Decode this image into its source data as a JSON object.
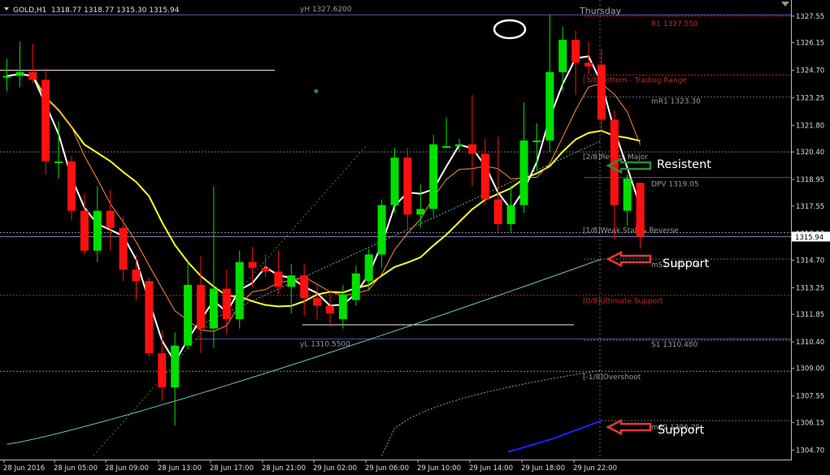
{
  "window": {
    "symbol_label": "GOLD,H1",
    "ohlc": "1318.77 1318.77 1315.30 1315.94",
    "day_label": "Thursday",
    "price_badge": "1315.94"
  },
  "chart_data": {
    "type": "candlestick",
    "title": "GOLD,H1",
    "symbol": "GOLD",
    "timeframe": "H1",
    "ylim": [
      1304.2,
      1328.4
    ],
    "y_ticks": [
      "1327.55",
      "1326.15",
      "1324.70",
      "1323.25",
      "1321.80",
      "1320.40",
      "1318.95",
      "1317.55",
      "1316.10",
      "1314.70",
      "1313.25",
      "1311.85",
      "1310.40",
      "1309.00",
      "1307.55",
      "1306.15",
      "1304.70"
    ],
    "x_ticks": [
      "28 Jun 2016",
      "28 Jun 05:00",
      "28 Jun 09:00",
      "28 Jun 13:00",
      "28 Jun 17:00",
      "28 Jun 21:00",
      "29 Jun 02:00",
      "29 Jun 06:00",
      "29 Jun 10:00",
      "29 Jun 14:00",
      "29 Jun 18:00",
      "29 Jun 22:00"
    ],
    "current_price": 1315.94,
    "candles": [
      {
        "o": 1324.4,
        "h": 1325.3,
        "l": 1323.6,
        "c": 1324.4
      },
      {
        "o": 1324.4,
        "h": 1326.2,
        "l": 1323.8,
        "c": 1324.6
      },
      {
        "o": 1324.6,
        "h": 1326.1,
        "l": 1324.0,
        "c": 1324.2
      },
      {
        "o": 1324.2,
        "h": 1324.8,
        "l": 1319.2,
        "c": 1319.9
      },
      {
        "o": 1319.9,
        "h": 1322.0,
        "l": 1319.0,
        "c": 1319.9
      },
      {
        "o": 1319.9,
        "h": 1320.2,
        "l": 1316.8,
        "c": 1317.3
      },
      {
        "o": 1317.3,
        "h": 1318.2,
        "l": 1315.0,
        "c": 1315.2
      },
      {
        "o": 1315.2,
        "h": 1318.6,
        "l": 1314.6,
        "c": 1317.3
      },
      {
        "o": 1317.3,
        "h": 1318.4,
        "l": 1315.2,
        "c": 1316.4
      },
      {
        "o": 1316.4,
        "h": 1317.0,
        "l": 1313.6,
        "c": 1314.2
      },
      {
        "o": 1314.2,
        "h": 1315.0,
        "l": 1312.6,
        "c": 1313.6
      },
      {
        "o": 1313.6,
        "h": 1313.8,
        "l": 1309.6,
        "c": 1309.8
      },
      {
        "o": 1309.8,
        "h": 1311.0,
        "l": 1307.3,
        "c": 1308.0
      },
      {
        "o": 1308.0,
        "h": 1310.9,
        "l": 1306.0,
        "c": 1310.2
      },
      {
        "o": 1310.2,
        "h": 1314.6,
        "l": 1310.0,
        "c": 1313.4
      },
      {
        "o": 1313.4,
        "h": 1314.9,
        "l": 1309.8,
        "c": 1311.1
      },
      {
        "o": 1311.1,
        "h": 1318.6,
        "l": 1310.1,
        "c": 1313.2
      },
      {
        "o": 1313.2,
        "h": 1314.2,
        "l": 1310.8,
        "c": 1311.6
      },
      {
        "o": 1311.6,
        "h": 1315.2,
        "l": 1311.1,
        "c": 1314.6
      },
      {
        "o": 1314.6,
        "h": 1315.4,
        "l": 1313.3,
        "c": 1314.3
      },
      {
        "o": 1314.3,
        "h": 1315.0,
        "l": 1313.8,
        "c": 1314.1
      },
      {
        "o": 1314.1,
        "h": 1315.2,
        "l": 1312.9,
        "c": 1313.3
      },
      {
        "o": 1313.3,
        "h": 1314.5,
        "l": 1311.9,
        "c": 1313.9
      },
      {
        "o": 1313.9,
        "h": 1314.5,
        "l": 1311.8,
        "c": 1312.7
      },
      {
        "o": 1312.7,
        "h": 1313.4,
        "l": 1311.6,
        "c": 1312.3
      },
      {
        "o": 1312.3,
        "h": 1313.0,
        "l": 1311.2,
        "c": 1311.9
      },
      {
        "o": 1311.6,
        "h": 1313.4,
        "l": 1311.1,
        "c": 1312.9
      },
      {
        "o": 1312.6,
        "h": 1314.4,
        "l": 1312.3,
        "c": 1314.0
      },
      {
        "o": 1313.6,
        "h": 1315.3,
        "l": 1313.1,
        "c": 1315.0
      },
      {
        "o": 1315.0,
        "h": 1317.9,
        "l": 1314.3,
        "c": 1317.6
      },
      {
        "o": 1317.6,
        "h": 1320.6,
        "l": 1317.2,
        "c": 1320.1
      },
      {
        "o": 1320.1,
        "h": 1320.6,
        "l": 1316.3,
        "c": 1317.1
      },
      {
        "o": 1317.1,
        "h": 1318.7,
        "l": 1316.4,
        "c": 1317.4
      },
      {
        "o": 1317.4,
        "h": 1321.3,
        "l": 1317.0,
        "c": 1320.8
      },
      {
        "o": 1320.7,
        "h": 1322.2,
        "l": 1320.6,
        "c": 1320.7
      },
      {
        "o": 1320.7,
        "h": 1321.1,
        "l": 1320.4,
        "c": 1320.8
      },
      {
        "o": 1320.8,
        "h": 1323.4,
        "l": 1318.6,
        "c": 1320.3
      },
      {
        "o": 1320.3,
        "h": 1321.1,
        "l": 1317.6,
        "c": 1317.9
      },
      {
        "o": 1317.9,
        "h": 1321.2,
        "l": 1316.2,
        "c": 1316.6
      },
      {
        "o": 1316.6,
        "h": 1318.6,
        "l": 1316.2,
        "c": 1317.6
      },
      {
        "o": 1317.6,
        "h": 1323.0,
        "l": 1317.2,
        "c": 1321.0
      },
      {
        "o": 1321.0,
        "h": 1321.9,
        "l": 1319.4,
        "c": 1321.0
      },
      {
        "o": 1321.0,
        "h": 1327.6,
        "l": 1320.4,
        "c": 1324.6
      },
      {
        "o": 1324.6,
        "h": 1327.0,
        "l": 1323.6,
        "c": 1326.3
      },
      {
        "o": 1326.3,
        "h": 1326.8,
        "l": 1323.4,
        "c": 1325.1
      },
      {
        "o": 1325.1,
        "h": 1326.2,
        "l": 1324.5,
        "c": 1324.9
      },
      {
        "o": 1325.0,
        "h": 1325.8,
        "l": 1321.4,
        "c": 1322.1
      },
      {
        "o": 1322.1,
        "h": 1322.6,
        "l": 1315.8,
        "c": 1317.6
      },
      {
        "o": 1317.3,
        "h": 1319.2,
        "l": 1316.5,
        "c": 1319.0
      },
      {
        "o": 1318.77,
        "h": 1318.77,
        "l": 1315.3,
        "c": 1315.94
      }
    ],
    "levels": [
      {
        "label": "yH 1327.6200",
        "value": 1327.62,
        "color": "#5a5abf"
      },
      {
        "label": "R1 1327.550",
        "value": 1327.55,
        "color": "#c62828"
      },
      {
        "label": "[3/8]Bottom - Trading Range",
        "value": 1324.45,
        "color": "#c62828"
      },
      {
        "label": "mR1 1323.30",
        "value": 1323.3,
        "color": "#777777"
      },
      {
        "label": "[2/8]Revers Major",
        "value": 1320.4,
        "color": "#888888"
      },
      {
        "label": "DPV 1319.05",
        "value": 1319.05,
        "color": "#a040c0"
      },
      {
        "label": "[1/8]Weak Stall & Reverse",
        "value": 1316.15,
        "color": "#888888"
      },
      {
        "label": "mS1 1314.76",
        "value": 1314.76,
        "color": "#777777"
      },
      {
        "label": "[0/8]Ultimate Support",
        "value": 1312.85,
        "color": "#c62828"
      },
      {
        "label": "yL 1310.5500",
        "value": 1310.55,
        "color": "#5a5abf"
      },
      {
        "label": "S1 1310.480",
        "value": 1310.48,
        "color": "#777777"
      },
      {
        "label": "[-1/8]Overshoot",
        "value": 1308.85,
        "color": "#888888"
      },
      {
        "label": "mS2 1306.25",
        "value": 1306.25,
        "color": "#777777"
      }
    ],
    "annotations": [
      {
        "text": "Resistent",
        "arrow_color": "#2e8b3a"
      },
      {
        "text": "Support",
        "arrow_color": "#e53935"
      },
      {
        "text": "Support",
        "arrow_color": "#e53935"
      }
    ],
    "colors": {
      "bull": "#00e000",
      "bear": "#ff1010",
      "background": "#000000",
      "ma_fast": "#ffffff",
      "ma_mid": "#ff8c3a",
      "ma_slow": "#ffff30",
      "band": "#7fd6d6",
      "band_low": "#2020ff",
      "trend": "#2e8b3a"
    }
  }
}
